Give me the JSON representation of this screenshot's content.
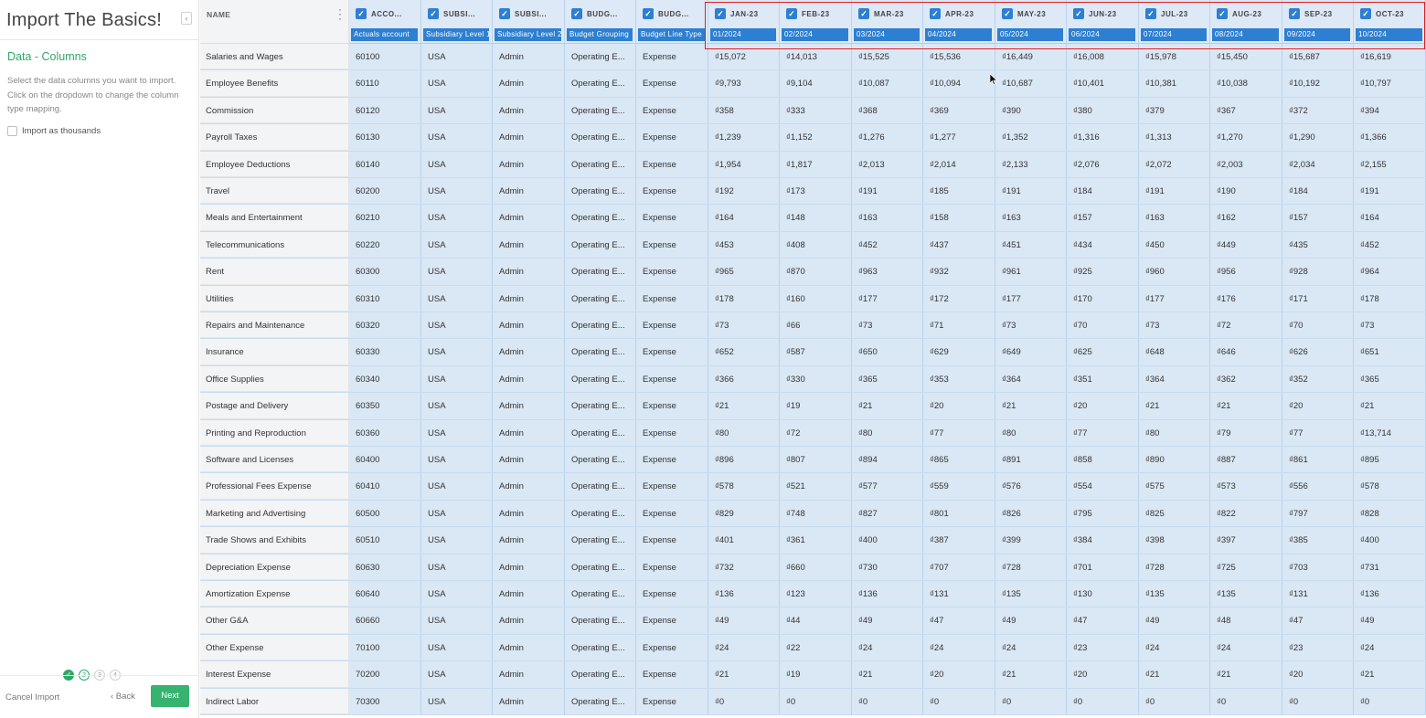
{
  "sidebar": {
    "title": "Import The Basics!",
    "step_title": "Data - Columns",
    "description": "Select the data columns you want to import. Click on the dropdown to change the column type mapping.",
    "import_thousands_label": "Import as thousands",
    "steps": [
      "✓",
      "2",
      "3",
      "4"
    ],
    "cancel_label": "Cancel Import",
    "back_label": "‹ Back",
    "next_label": "Next"
  },
  "grid": {
    "name_header": "NAME",
    "columns": [
      {
        "label": "ACCO...",
        "mapping": "Actuals account"
      },
      {
        "label": "SUBSI...",
        "mapping": "Subsidiary Level 1"
      },
      {
        "label": "SUBSI...",
        "mapping": "Subsidiary Level 2"
      },
      {
        "label": "BUDG...",
        "mapping": "Budget Grouping"
      },
      {
        "label": "BUDG...",
        "mapping": "Budget Line Type"
      },
      {
        "label": "JAN-23",
        "mapping": "01/2024"
      },
      {
        "label": "FEB-23",
        "mapping": "02/2024"
      },
      {
        "label": "MAR-23",
        "mapping": "03/2024"
      },
      {
        "label": "APR-23",
        "mapping": "04/2024"
      },
      {
        "label": "MAY-23",
        "mapping": "05/2024"
      },
      {
        "label": "JUN-23",
        "mapping": "06/2024"
      },
      {
        "label": "JUL-23",
        "mapping": "07/2024"
      },
      {
        "label": "AUG-23",
        "mapping": "08/2024"
      },
      {
        "label": "SEP-23",
        "mapping": "09/2024"
      },
      {
        "label": "OCT-23",
        "mapping": "10/2024"
      }
    ],
    "rows": [
      {
        "name": "Salaries and Wages",
        "cells": [
          "60100",
          "USA",
          "Admin",
          "Operating E...",
          "Expense",
          "₫15,072",
          "₫14,013",
          "₫15,525",
          "₫15,536",
          "₫16,449",
          "₫16,008",
          "₫15,978",
          "₫15,450",
          "₫15,687",
          "₫16,619"
        ]
      },
      {
        "name": "Employee Benefits",
        "cells": [
          "60110",
          "USA",
          "Admin",
          "Operating E...",
          "Expense",
          "₫9,793",
          "₫9,104",
          "₫10,087",
          "₫10,094",
          "₫10,687",
          "₫10,401",
          "₫10,381",
          "₫10,038",
          "₫10,192",
          "₫10,797"
        ]
      },
      {
        "name": "Commission",
        "cells": [
          "60120",
          "USA",
          "Admin",
          "Operating E...",
          "Expense",
          "₫358",
          "₫333",
          "₫368",
          "₫369",
          "₫390",
          "₫380",
          "₫379",
          "₫367",
          "₫372",
          "₫394"
        ]
      },
      {
        "name": "Payroll Taxes",
        "cells": [
          "60130",
          "USA",
          "Admin",
          "Operating E...",
          "Expense",
          "₫1,239",
          "₫1,152",
          "₫1,276",
          "₫1,277",
          "₫1,352",
          "₫1,316",
          "₫1,313",
          "₫1,270",
          "₫1,290",
          "₫1,366"
        ]
      },
      {
        "name": "Employee Deductions",
        "cells": [
          "60140",
          "USA",
          "Admin",
          "Operating E...",
          "Expense",
          "₫1,954",
          "₫1,817",
          "₫2,013",
          "₫2,014",
          "₫2,133",
          "₫2,076",
          "₫2,072",
          "₫2,003",
          "₫2,034",
          "₫2,155"
        ]
      },
      {
        "name": "Travel",
        "cells": [
          "60200",
          "USA",
          "Admin",
          "Operating E...",
          "Expense",
          "₫192",
          "₫173",
          "₫191",
          "₫185",
          "₫191",
          "₫184",
          "₫191",
          "₫190",
          "₫184",
          "₫191"
        ]
      },
      {
        "name": "Meals and Entertainment",
        "cells": [
          "60210",
          "USA",
          "Admin",
          "Operating E...",
          "Expense",
          "₫164",
          "₫148",
          "₫163",
          "₫158",
          "₫163",
          "₫157",
          "₫163",
          "₫162",
          "₫157",
          "₫164"
        ]
      },
      {
        "name": "Telecommunications",
        "cells": [
          "60220",
          "USA",
          "Admin",
          "Operating E...",
          "Expense",
          "₫453",
          "₫408",
          "₫452",
          "₫437",
          "₫451",
          "₫434",
          "₫450",
          "₫449",
          "₫435",
          "₫452"
        ]
      },
      {
        "name": "Rent",
        "cells": [
          "60300",
          "USA",
          "Admin",
          "Operating E...",
          "Expense",
          "₫965",
          "₫870",
          "₫963",
          "₫932",
          "₫961",
          "₫925",
          "₫960",
          "₫956",
          "₫928",
          "₫964"
        ]
      },
      {
        "name": "Utilities",
        "cells": [
          "60310",
          "USA",
          "Admin",
          "Operating E...",
          "Expense",
          "₫178",
          "₫160",
          "₫177",
          "₫172",
          "₫177",
          "₫170",
          "₫177",
          "₫176",
          "₫171",
          "₫178"
        ]
      },
      {
        "name": "Repairs and Maintenance",
        "cells": [
          "60320",
          "USA",
          "Admin",
          "Operating E...",
          "Expense",
          "₫73",
          "₫66",
          "₫73",
          "₫71",
          "₫73",
          "₫70",
          "₫73",
          "₫72",
          "₫70",
          "₫73"
        ]
      },
      {
        "name": "Insurance",
        "cells": [
          "60330",
          "USA",
          "Admin",
          "Operating E...",
          "Expense",
          "₫652",
          "₫587",
          "₫650",
          "₫629",
          "₫649",
          "₫625",
          "₫648",
          "₫646",
          "₫626",
          "₫651"
        ]
      },
      {
        "name": "Office Supplies",
        "cells": [
          "60340",
          "USA",
          "Admin",
          "Operating E...",
          "Expense",
          "₫366",
          "₫330",
          "₫365",
          "₫353",
          "₫364",
          "₫351",
          "₫364",
          "₫362",
          "₫352",
          "₫365"
        ]
      },
      {
        "name": "Postage and Delivery",
        "cells": [
          "60350",
          "USA",
          "Admin",
          "Operating E...",
          "Expense",
          "₫21",
          "₫19",
          "₫21",
          "₫20",
          "₫21",
          "₫20",
          "₫21",
          "₫21",
          "₫20",
          "₫21"
        ]
      },
      {
        "name": "Printing and Reproduction",
        "cells": [
          "60360",
          "USA",
          "Admin",
          "Operating E...",
          "Expense",
          "₫80",
          "₫72",
          "₫80",
          "₫77",
          "₫80",
          "₫77",
          "₫80",
          "₫79",
          "₫77",
          "₫13,714"
        ]
      },
      {
        "name": "Software and Licenses",
        "cells": [
          "60400",
          "USA",
          "Admin",
          "Operating E...",
          "Expense",
          "₫896",
          "₫807",
          "₫894",
          "₫865",
          "₫891",
          "₫858",
          "₫890",
          "₫887",
          "₫861",
          "₫895"
        ]
      },
      {
        "name": "Professional Fees Expense",
        "cells": [
          "60410",
          "USA",
          "Admin",
          "Operating E...",
          "Expense",
          "₫578",
          "₫521",
          "₫577",
          "₫559",
          "₫576",
          "₫554",
          "₫575",
          "₫573",
          "₫556",
          "₫578"
        ]
      },
      {
        "name": "Marketing and Advertising",
        "cells": [
          "60500",
          "USA",
          "Admin",
          "Operating E...",
          "Expense",
          "₫829",
          "₫748",
          "₫827",
          "₫801",
          "₫826",
          "₫795",
          "₫825",
          "₫822",
          "₫797",
          "₫828"
        ]
      },
      {
        "name": "Trade Shows and Exhibits",
        "cells": [
          "60510",
          "USA",
          "Admin",
          "Operating E...",
          "Expense",
          "₫401",
          "₫361",
          "₫400",
          "₫387",
          "₫399",
          "₫384",
          "₫398",
          "₫397",
          "₫385",
          "₫400"
        ]
      },
      {
        "name": "Depreciation Expense",
        "cells": [
          "60630",
          "USA",
          "Admin",
          "Operating E...",
          "Expense",
          "₫732",
          "₫660",
          "₫730",
          "₫707",
          "₫728",
          "₫701",
          "₫728",
          "₫725",
          "₫703",
          "₫731"
        ]
      },
      {
        "name": "Amortization Expense",
        "cells": [
          "60640",
          "USA",
          "Admin",
          "Operating E...",
          "Expense",
          "₫136",
          "₫123",
          "₫136",
          "₫131",
          "₫135",
          "₫130",
          "₫135",
          "₫135",
          "₫131",
          "₫136"
        ]
      },
      {
        "name": "Other G&A",
        "cells": [
          "60660",
          "USA",
          "Admin",
          "Operating E...",
          "Expense",
          "₫49",
          "₫44",
          "₫49",
          "₫47",
          "₫49",
          "₫47",
          "₫49",
          "₫48",
          "₫47",
          "₫49"
        ]
      },
      {
        "name": "Other Expense",
        "cells": [
          "70100",
          "USA",
          "Admin",
          "Operating E...",
          "Expense",
          "₫24",
          "₫22",
          "₫24",
          "₫24",
          "₫24",
          "₫23",
          "₫24",
          "₫24",
          "₫23",
          "₫24"
        ]
      },
      {
        "name": "Interest Expense",
        "cells": [
          "70200",
          "USA",
          "Admin",
          "Operating E...",
          "Expense",
          "₫21",
          "₫19",
          "₫21",
          "₫20",
          "₫21",
          "₫20",
          "₫21",
          "₫21",
          "₫20",
          "₫21"
        ]
      },
      {
        "name": "Indirect Labor",
        "cells": [
          "70300",
          "USA",
          "Admin",
          "Operating E...",
          "Expense",
          "₫0",
          "₫0",
          "₫0",
          "₫0",
          "₫0",
          "₫0",
          "₫0",
          "₫0",
          "₫0",
          "₫0"
        ]
      }
    ]
  },
  "colors": {
    "accent_green": "#36b36e",
    "mapping_blue": "#2d7fd2",
    "selected_cell": "#dae7f5",
    "highlight_box": "#e02020"
  }
}
